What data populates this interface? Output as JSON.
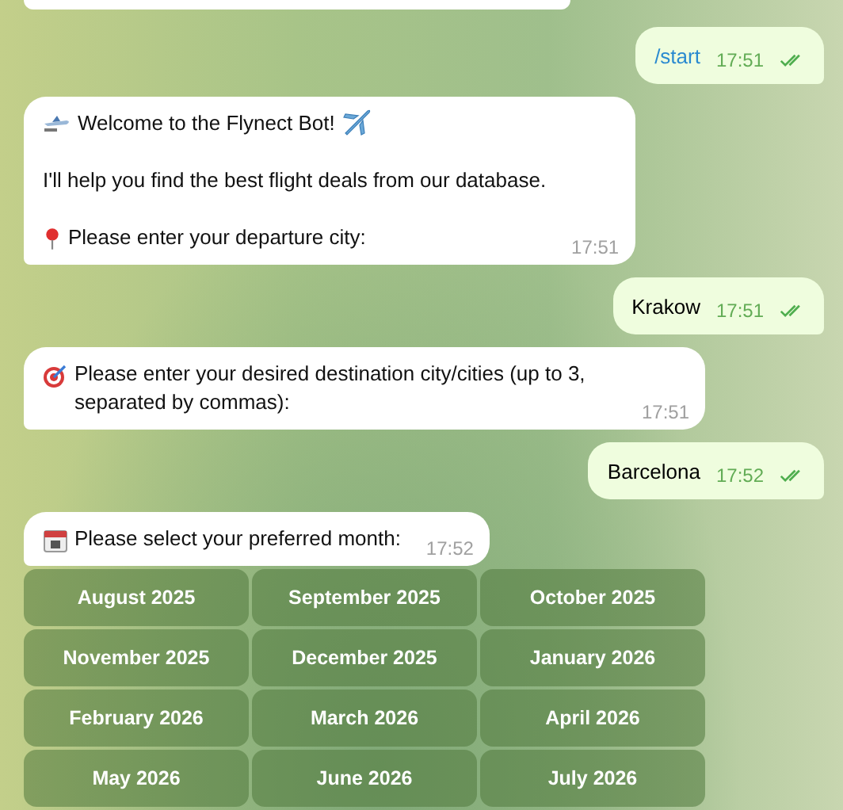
{
  "messages": [
    {
      "kind": "outgoing",
      "text": "/start",
      "command": true,
      "time": "17:51",
      "read": true
    },
    {
      "kind": "incoming",
      "paragraphs": [
        "Welcome to the Flynect Bot!",
        "I'll help you find the best flight deals from our database.",
        "Please enter your departure city:"
      ],
      "time": "17:51"
    },
    {
      "kind": "outgoing",
      "text": "Krakow",
      "command": false,
      "time": "17:51",
      "read": true
    },
    {
      "kind": "incoming",
      "paragraphs": [
        "Please enter your desired destination city/cities (up to 3, separated by commas):"
      ],
      "time": "17:51"
    },
    {
      "kind": "outgoing",
      "text": "Barcelona",
      "command": false,
      "time": "17:52",
      "read": true
    },
    {
      "kind": "incoming",
      "paragraphs": [
        "Please select your preferred month:"
      ],
      "time": "17:52"
    }
  ],
  "keyboard": [
    [
      "August 2025",
      "September 2025",
      "October 2025"
    ],
    [
      "November 2025",
      "December 2025",
      "January 2026"
    ],
    [
      "February 2026",
      "March 2026",
      "April 2026"
    ],
    [
      "May 2026",
      "June 2026",
      "July 2026"
    ]
  ]
}
